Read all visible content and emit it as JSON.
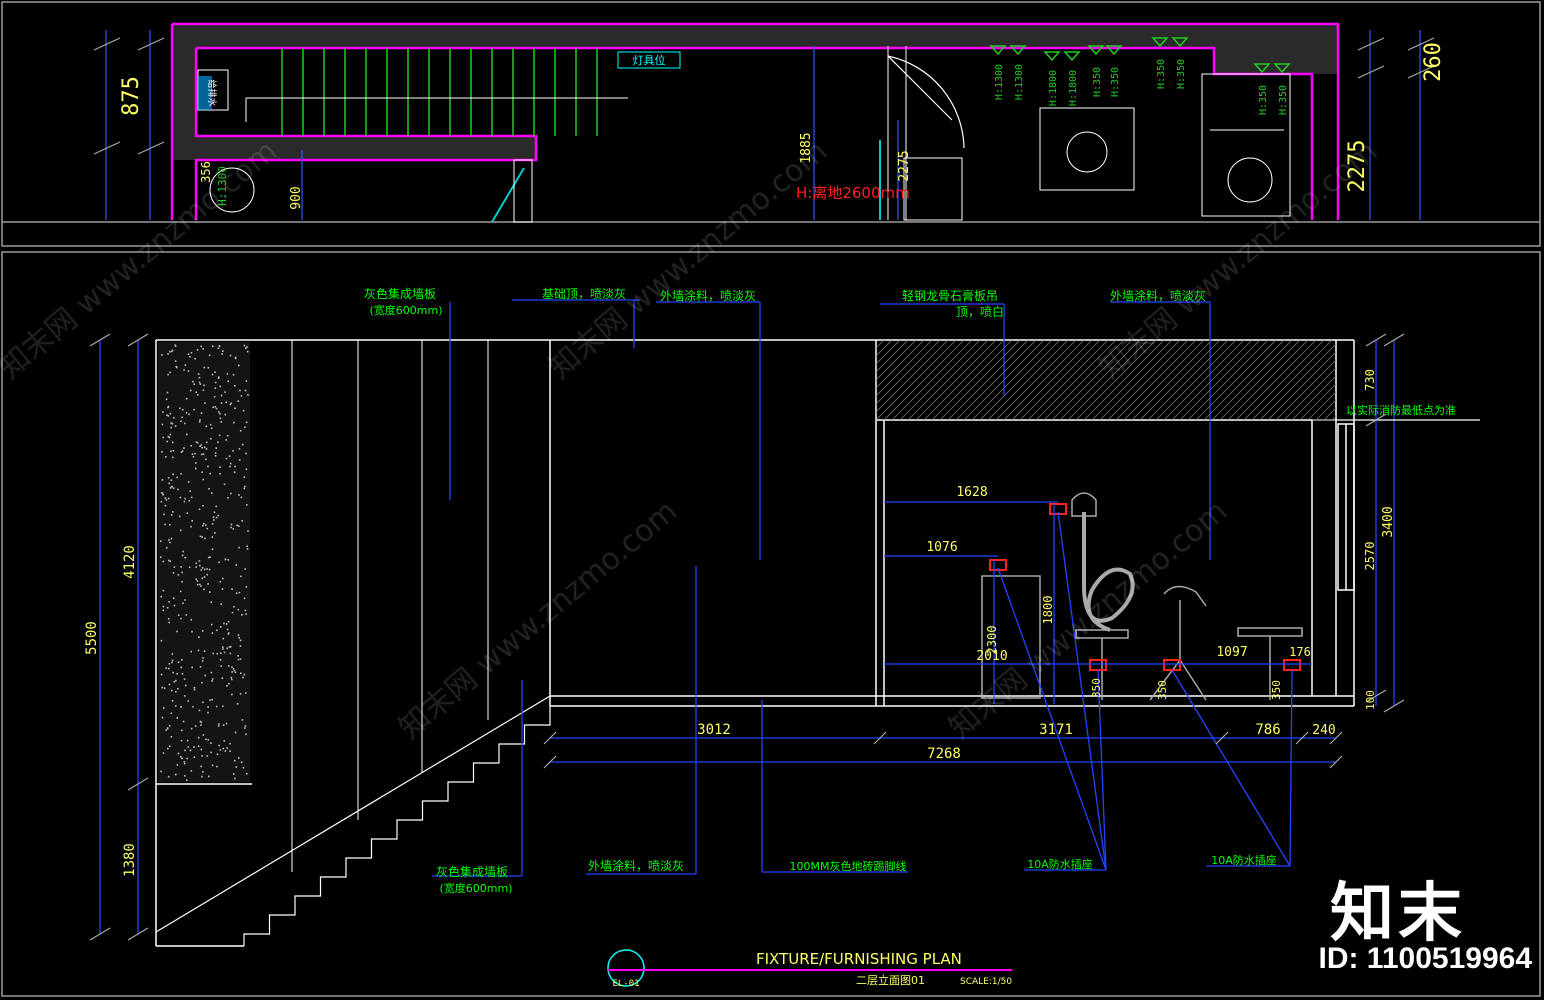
{
  "colors": {
    "background": "#000000",
    "wall_outline": "#ff00ff",
    "wall_fill": "#2a2a2a",
    "stair_treads": "#22cc22",
    "dimension": "#0000ff",
    "dimension_text": "#ffff66",
    "annotation": "#00ff00",
    "elevation_outline": "#ffffff",
    "leader": "#0000ff",
    "socket_mark": "#ff2020",
    "note_red": "#ff2020",
    "hose_fixture": "#aaaaaa"
  },
  "plan_view": {
    "dims_left": [
      "875"
    ],
    "dims_right": [
      "260",
      "2275"
    ],
    "dim_vertical": [
      "1885",
      "2275",
      "900",
      "356"
    ],
    "elevation_note": "H:离地2600mm",
    "tags": {
      "left_symbol": "给排水",
      "top_label": "灯具位",
      "height_tags": [
        "H:1300",
        "H:1300",
        "H:1800",
        "H:1800",
        "H:350",
        "H:350",
        "H:350",
        "H:350",
        "H:350",
        "H:350"
      ],
      "left_tag": "H:1300"
    }
  },
  "elevation": {
    "top_annotations": [
      {
        "text": "灰色集成墙板",
        "sub": "(宽度600mm)"
      },
      {
        "text": "基础顶，喷淡灰"
      },
      {
        "text": "外墙涂料，喷淡灰"
      },
      {
        "text": "轻钢龙骨石膏板吊",
        "sub": "顶，喷白"
      },
      {
        "text": "外墙涂料，喷淡灰"
      }
    ],
    "right_note": "以实际消防最低点为准",
    "bottom_annotations": [
      {
        "text": "灰色集成墙板",
        "sub": "(宽度600mm)"
      },
      {
        "text": "外墙涂料，喷淡灰"
      },
      {
        "text": "100MM灰色地砖踢脚线"
      },
      {
        "text": "10A防水插座"
      },
      {
        "text": "10A防水插座"
      }
    ],
    "dims_left": [
      "5500",
      "4120",
      "1380"
    ],
    "dims_right": [
      "730",
      "3400",
      "2570",
      "100"
    ],
    "inner_dims": [
      "1628",
      "1076",
      "1800",
      "2300",
      "2010",
      "350",
      "350",
      "350",
      "1097",
      "176"
    ],
    "bottom_dims": [
      "3012",
      "3171",
      "786",
      "240"
    ],
    "total_dim": "7268"
  },
  "title_block": {
    "symbol": "EL-01",
    "title": "FIXTURE/FURNISHING PLAN",
    "subtitle": "二层立面图01",
    "scale": "SCALE:1/50"
  },
  "branding": {
    "logo": "知末",
    "id_text": "ID: 1100519964",
    "watermark": "知末网 www.znzmo.com"
  }
}
